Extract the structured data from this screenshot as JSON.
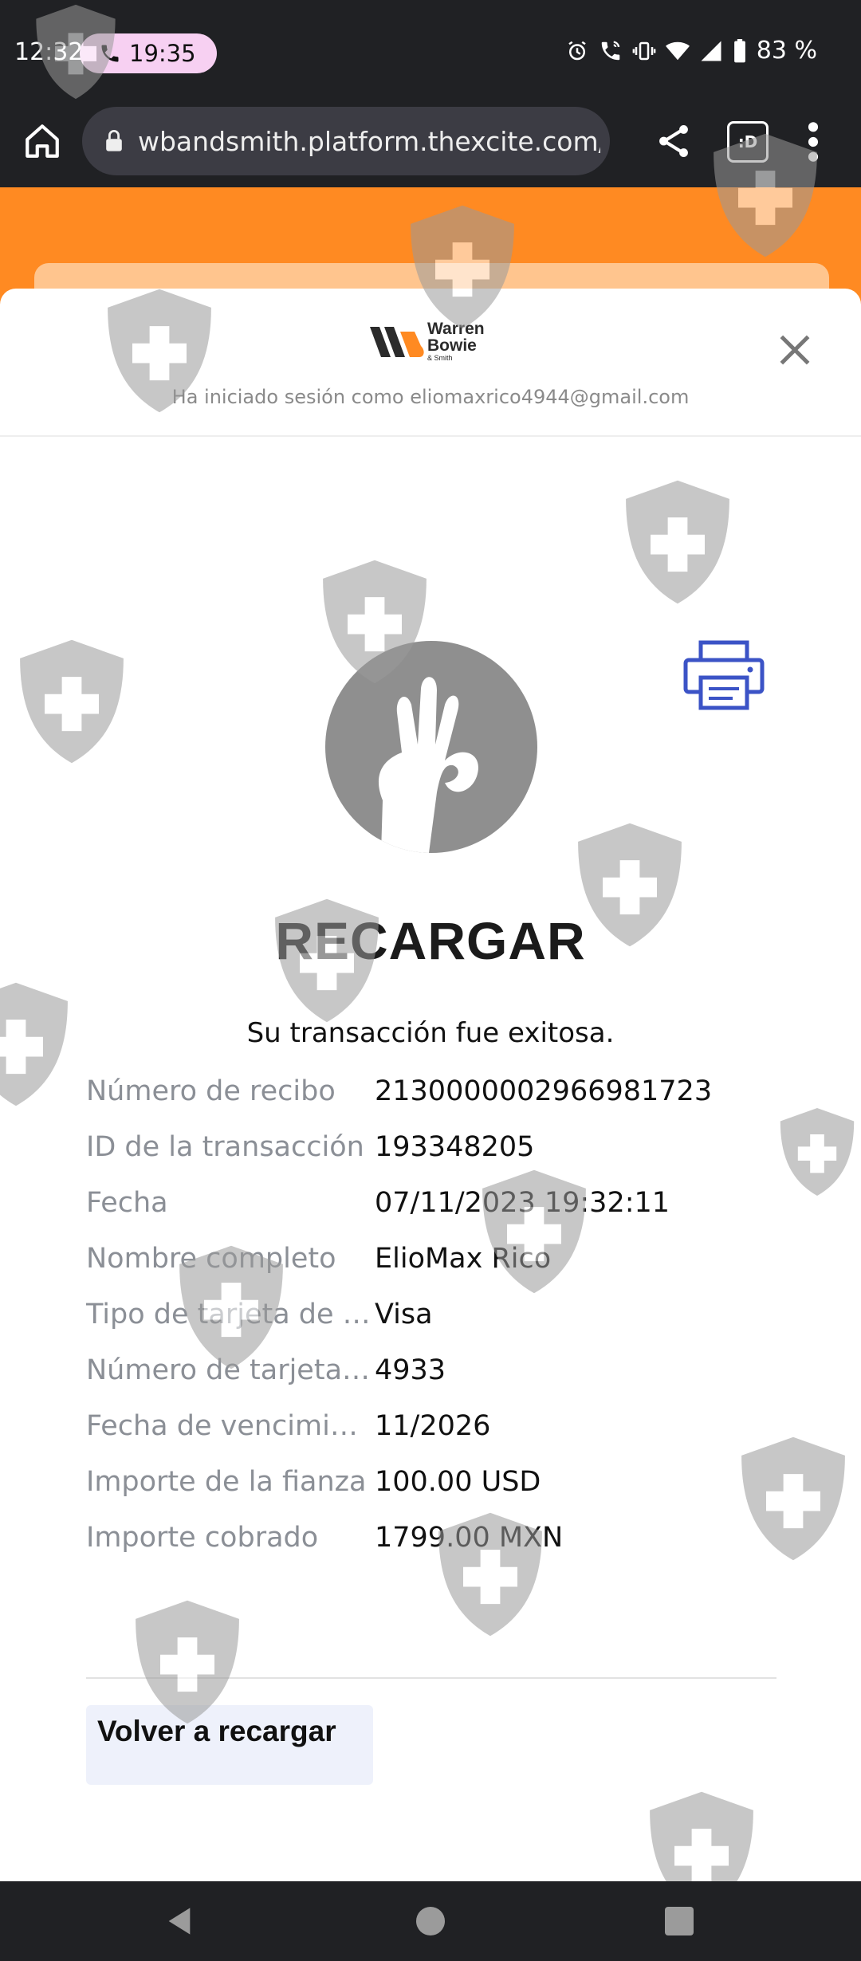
{
  "status_bar": {
    "time": "12:32",
    "call_timer": "19:35",
    "battery": "83 %"
  },
  "browser": {
    "url": "wbandsmith.platform.thexcite.com/a",
    "tab_label": ":D"
  },
  "brand": {
    "logo_line1": "Warren",
    "logo_line2": "Bowie",
    "logo_line3": "& Smith",
    "accent_orange": "#ff8a22",
    "print_icon_color": "#3b53c6"
  },
  "header": {
    "logged_in_text": "Ha iniciado sesión como eliomaxrico4944@gmail.com"
  },
  "receipt": {
    "title": "RECARGAR",
    "success_message": "Su transacción fue exitosa.",
    "rows": [
      {
        "label": "Número de recibo",
        "value": "2130000002966981723"
      },
      {
        "label": "ID de la transacción",
        "value": "193348205"
      },
      {
        "label": "Fecha",
        "value": "07/11/2023 19:32:11"
      },
      {
        "label": "Nombre completo",
        "value": "ElioMax Rico"
      },
      {
        "label": "Tipo de tarjeta de …",
        "value": "Visa"
      },
      {
        "label": "Número de tarjeta…",
        "value": "4933"
      },
      {
        "label": "Fecha de vencimi…",
        "value": "11/2026"
      },
      {
        "label": "Importe de la fianza",
        "value": "100.00 USD"
      },
      {
        "label": "Importe cobrado",
        "value": "1799.00 MXN"
      }
    ],
    "back_button": "Volver a recargar"
  }
}
